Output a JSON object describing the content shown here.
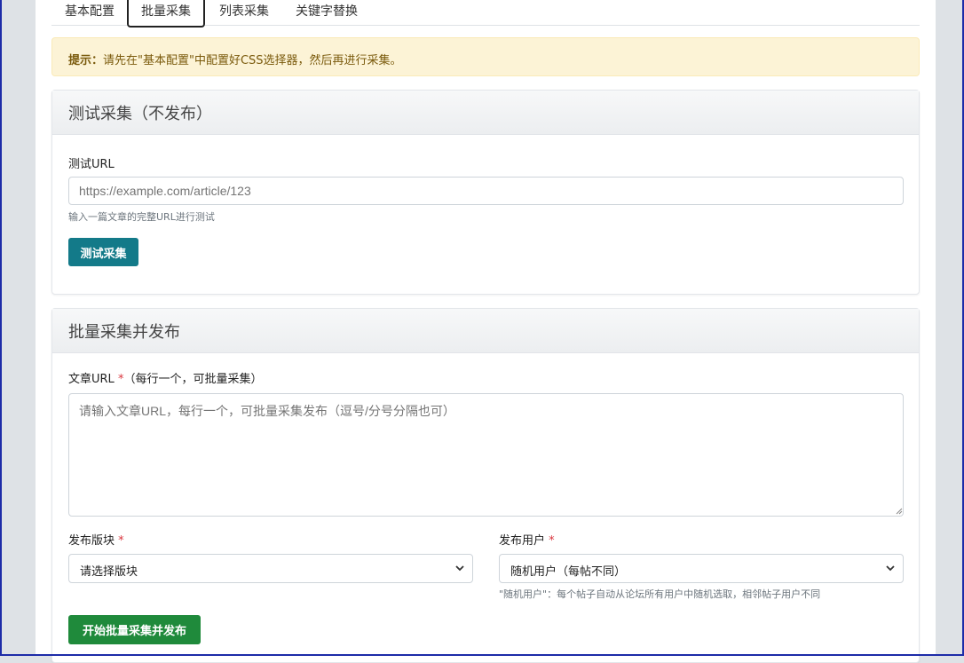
{
  "tabs": [
    {
      "label": "基本配置"
    },
    {
      "label": "批量采集",
      "active": true
    },
    {
      "label": "列表采集"
    },
    {
      "label": "关键字替换"
    }
  ],
  "alert": {
    "prefix": "提示：",
    "text": "请先在\"基本配置\"中配置好CSS选择器，然后再进行采集。"
  },
  "test_card": {
    "title": "测试采集（不发布）",
    "url_label": "测试URL",
    "url_placeholder": "https://example.com/article/123",
    "url_help": "输入一篇文章的完整URL进行测试",
    "button": "测试采集",
    "button_color": "#137a89"
  },
  "batch_card": {
    "title": "批量采集并发布",
    "urls_label": "文章URL",
    "required_mark": "*",
    "urls_hint": "（每行一个，可批量采集）",
    "urls_placeholder": "请输入文章URL，每行一个，可批量采集发布（逗号/分号分隔也可）",
    "forum_label": "发布版块",
    "forum_selected": "请选择版块",
    "user_label": "发布用户",
    "user_selected": "随机用户（每帖不同）",
    "user_help": "\"随机用户\"：每个帖子自动从论坛所有用户中随机选取，相邻帖子用户不同",
    "button": "开始批量采集并发布",
    "button_color": "#1f8a3b"
  }
}
